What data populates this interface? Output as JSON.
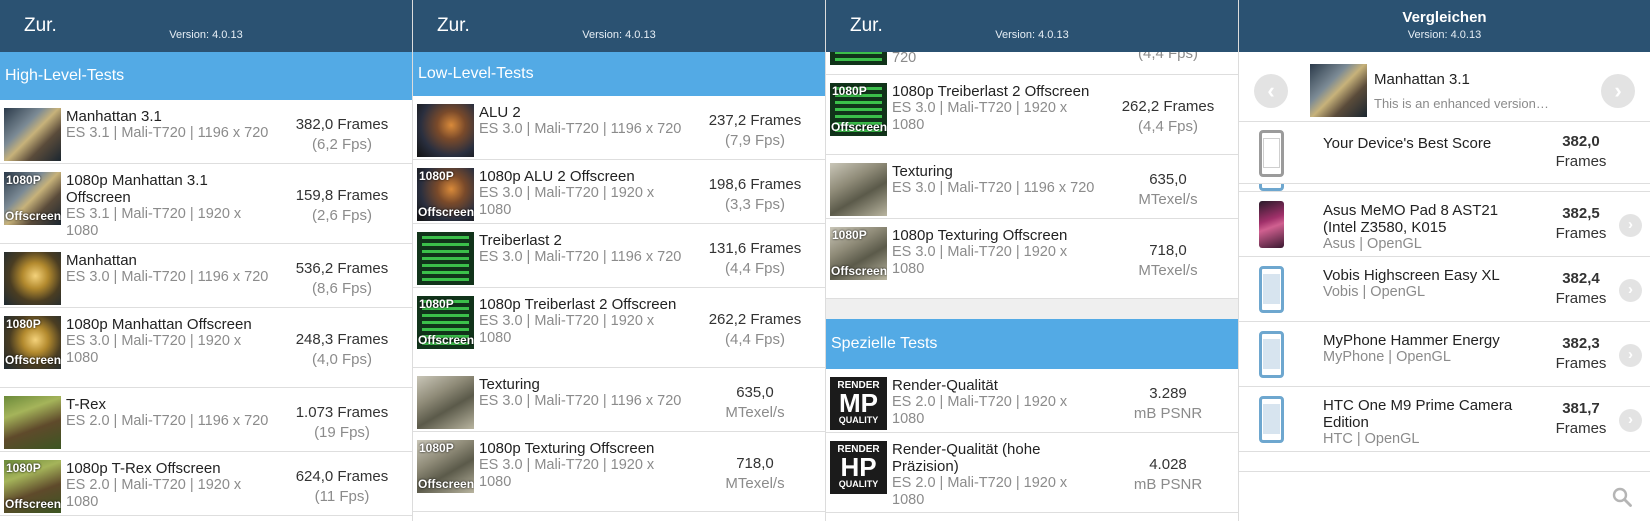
{
  "header": {
    "back": "Zur.",
    "version": "Version: 4.0.13",
    "compare_title": "Vergleichen"
  },
  "panel1": {
    "section": "High-Level-Tests",
    "rows": [
      {
        "name": "Manhattan 3.1",
        "sub": "ES 3.1 | Mali-T720 | 1196 x 720",
        "main": "382,0 Frames",
        "sec": "(6,2 Fps)",
        "thumb": "robot"
      },
      {
        "name": "1080p Manhattan 3.1 Offscreen",
        "sub": "ES 3.1 | Mali-T720 | 1920 x 1080",
        "main": "159,8 Frames",
        "sec": "(2,6 Fps)",
        "thumb": "robot",
        "badge_top": "1080P",
        "badge_bot": "Offscreen"
      },
      {
        "name": "Manhattan",
        "sub": "ES 3.0 | Mali-T720 | 1196 x 720",
        "main": "536,2 Frames",
        "sec": "(8,6 Fps)",
        "thumb": "gold"
      },
      {
        "name": "1080p Manhattan Offscreen",
        "sub": "ES 3.0 | Mali-T720 | 1920 x 1080",
        "main": "248,3 Frames",
        "sec": "(4,0 Fps)",
        "thumb": "gold",
        "badge_top": "1080P",
        "badge_bot": "Offscreen"
      },
      {
        "name": "T-Rex",
        "sub": "ES 2.0 | Mali-T720 | 1196 x 720",
        "main": "1.073 Frames",
        "sec": "(19 Fps)",
        "thumb": "trex"
      },
      {
        "name": "1080p T-Rex Offscreen",
        "sub": "ES 2.0 | Mali-T720 | 1920 x 1080",
        "main": "624,0 Frames",
        "sec": "(11 Fps)",
        "thumb": "trex",
        "badge_top": "1080P",
        "badge_bot": "Offscreen"
      }
    ]
  },
  "panel2": {
    "section": "Low-Level-Tests",
    "rows": [
      {
        "name": "ALU 2",
        "sub": "ES 3.0 | Mali-T720 | 1196 x 720",
        "main": "237,2 Frames",
        "sec": "(7,9 Fps)",
        "thumb": "alu"
      },
      {
        "name": "1080p ALU 2 Offscreen",
        "sub": "ES 3.0 | Mali-T720 | 1920 x 1080",
        "main": "198,6 Frames",
        "sec": "(3,3 Fps)",
        "thumb": "alu",
        "badge_top": "1080P",
        "badge_bot": "Offscreen"
      },
      {
        "name": "Treiberlast 2",
        "sub": "ES 3.0 | Mali-T720 | 1196 x 720",
        "main": "131,6 Frames",
        "sec": "(4,4 Fps)",
        "thumb": "green"
      },
      {
        "name": "1080p Treiberlast 2 Offscreen",
        "sub": "ES 3.0 | Mali-T720 | 1920 x 1080",
        "main": "262,2 Frames",
        "sec": "(4,4 Fps)",
        "thumb": "green",
        "badge_top": "1080P",
        "badge_bot": "Offscreen"
      },
      {
        "name": "Texturing",
        "sub": "ES 3.0 | Mali-T720 | 1196 x 720",
        "main": "635,0",
        "sec": "MTexel/s",
        "thumb": "rock"
      },
      {
        "name": "1080p Texturing Offscreen",
        "sub": "ES 3.0 | Mali-T720 | 1920 x 1080",
        "main": "718,0",
        "sec": "MTexel/s",
        "thumb": "rock",
        "badge_top": "1080P",
        "badge_bot": "Offscreen"
      }
    ]
  },
  "panel3": {
    "partial": {
      "sub": "720",
      "sec": "(4,4 Fps)"
    },
    "rows": [
      {
        "name": "1080p Treiberlast 2 Offscreen",
        "sub": "ES 3.0 | Mali-T720 | 1920 x 1080",
        "main": "262,2 Frames",
        "sec": "(4,4 Fps)",
        "thumb": "green",
        "badge_top": "1080P",
        "badge_bot": "Offscreen"
      },
      {
        "name": "Texturing",
        "sub": "ES 3.0 | Mali-T720 | 1196 x 720",
        "main": "635,0",
        "sec": "MTexel/s",
        "thumb": "rock"
      },
      {
        "name": "1080p Texturing Offscreen",
        "sub": "ES 3.0 | Mali-T720 | 1920 x 1080",
        "main": "718,0",
        "sec": "MTexel/s",
        "thumb": "rock",
        "badge_top": "1080P",
        "badge_bot": "Offscreen"
      }
    ],
    "section": "Spezielle Tests",
    "special": [
      {
        "name": "Render-Qualität",
        "sub": "ES 2.0 | Mali-T720 | 1920 x 1080",
        "main": "3.289",
        "sec": "mB PSNR",
        "q1": "RENDER",
        "q2": "MP",
        "q3": "QUALITY"
      },
      {
        "name": "Render-Qualität (hohe Präzision)",
        "sub": "ES 2.0 | Mali-T720 | 1920 x 1080",
        "main": "4.028",
        "sec": "mB PSNR",
        "q1": "RENDER",
        "q2": "HP",
        "q3": "QUALITY"
      }
    ]
  },
  "panel4": {
    "test_name": "Manhattan 3.1",
    "test_desc": "This is an enhanced version of t...",
    "best": {
      "name": "Your Device's Best Score",
      "score": "382,0",
      "unit": "Frames"
    },
    "devices": [
      {
        "name": "Asus MeMO Pad 8 AST21 (Intel Z3580, K015",
        "sub": "Asus | OpenGL",
        "score": "382,5",
        "unit": "Frames",
        "icon": "asus"
      },
      {
        "name": "Vobis Highscreen Easy XL",
        "sub": "Vobis | OpenGL",
        "score": "382,4",
        "unit": "Frames",
        "icon": "phone"
      },
      {
        "name": "MyPhone Hammer Energy",
        "sub": "MyPhone | OpenGL",
        "score": "382,3",
        "unit": "Frames",
        "icon": "phone"
      },
      {
        "name": "HTC One M9 Prime Camera Edition",
        "sub": "HTC | OpenGL",
        "score": "381,7",
        "unit": "Frames",
        "icon": "phone"
      }
    ]
  },
  "colors": {
    "header": "#2b5272",
    "section": "#53aae5",
    "phone_icon": "#6ea7cf"
  }
}
